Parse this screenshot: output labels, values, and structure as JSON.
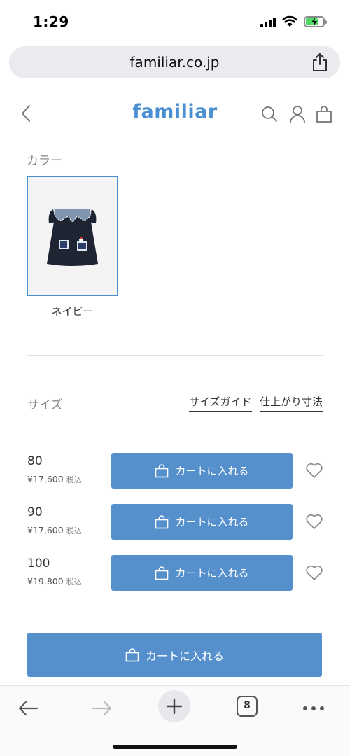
{
  "status_bar": {
    "time": "1:29"
  },
  "browser": {
    "url": "familiar.co.jp",
    "tab_count": "8"
  },
  "site": {
    "logo": "familiar"
  },
  "color_section": {
    "label": "カラー",
    "selected_color": "ネイビー"
  },
  "size_section": {
    "label": "サイズ",
    "size_guide_link": "サイズガイド",
    "finished_dimensions_link": "仕上がり寸法",
    "tax_label": "税込",
    "cart_button_label": "カートに入れる",
    "sizes": [
      {
        "size": "80",
        "price": "¥17,600"
      },
      {
        "size": "90",
        "price": "¥17,600"
      },
      {
        "size": "100",
        "price": "¥19,800"
      }
    ]
  },
  "main_cart_button": {
    "label": "カートに入れる"
  },
  "colors": {
    "accent": "#4a8fd2",
    "button": "#5590cc"
  }
}
